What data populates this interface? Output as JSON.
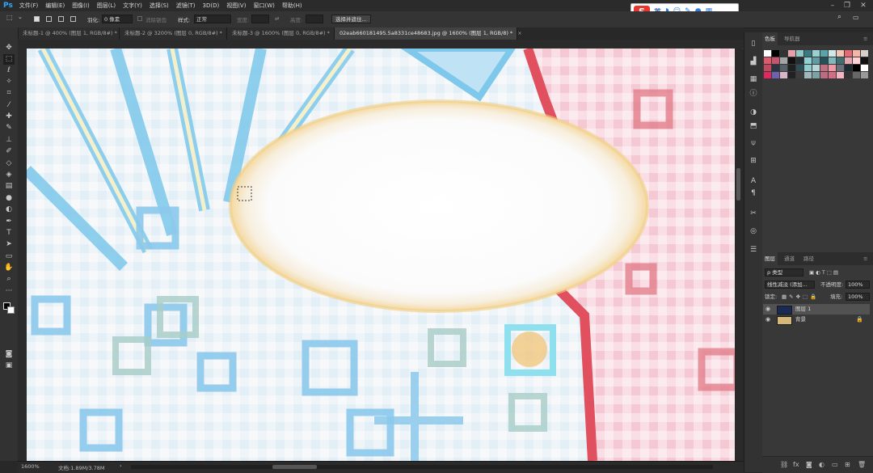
{
  "app": {
    "logo": "Ps"
  },
  "menu": [
    "文件(F)",
    "编辑(E)",
    "图像(I)",
    "图层(L)",
    "文字(Y)",
    "选择(S)",
    "滤镜(T)",
    "3D(D)",
    "视图(V)",
    "窗口(W)",
    "帮助(H)"
  ],
  "ime": {
    "logo": "S",
    "lang": "英",
    "icons": [
      "moon-icon",
      "smile-icon",
      "pen-icon",
      "mic-icon",
      "grid-icon"
    ]
  },
  "options": {
    "feather_label": "羽化:",
    "feather_value": "0 像素",
    "antialias_label": "消除锯齿",
    "style_label": "样式:",
    "style_value": "正常",
    "width_label": "宽度:",
    "height_label": "高度:",
    "select_mask_button": "选择并遮住..."
  },
  "tabs": [
    {
      "label": "未标题-1 @ 400% (图层 1, RGB/8#) *",
      "active": false
    },
    {
      "label": "未标题-2 @ 3200% (图层 0, RGB/8#) *",
      "active": false
    },
    {
      "label": "未标题-3 @ 1600% (图层 0, RGB/8#) *",
      "active": false
    },
    {
      "label": "02eab660181495.5a8331ce48683.jpg @ 1600% (图层 1, RGB/8) *",
      "active": true
    }
  ],
  "status": {
    "zoom": "1600%",
    "doc": "文档:1.89M/3.78M"
  },
  "panels": {
    "swatch_tabs": [
      "色板",
      "导航器"
    ],
    "swatches": [
      "#ffffff",
      "#000000",
      "#333333",
      "#e8a0a8",
      "#8fc9c7",
      "#3b7a83",
      "#9bcfd0",
      "#5aa3a8",
      "#d0e8ea",
      "#f2c7b2",
      "#e46a75",
      "#f5b6a8",
      "#d8d0c8",
      "#e0586a",
      "#c7536d",
      "#a4a4a4",
      "#111111",
      "#262e35",
      "#8ed1d3",
      "#5e9da4",
      "#245157",
      "#7fb9bd",
      "#3d6f74",
      "#e5a8b0",
      "#ffd1d6",
      "#111111",
      "#c04a62",
      "#2a3340",
      "#556068",
      "#202020",
      "#2c4f57",
      "#90cbcd",
      "#b7d6d9",
      "#c07082",
      "#f09aa8",
      "#6c707a",
      "#1c2a33",
      "#000000",
      "#ffffff",
      "#e0285e",
      "#6c63b0",
      "#d9b5c8",
      "#222222",
      "#3d3d3d",
      "#9fb7ba",
      "#7aa2a8",
      "#be6a80",
      "#d66b85",
      "#f3b5c2",
      "#333333",
      "#666666",
      "#999999"
    ],
    "layer_tabs": [
      "图层",
      "通道",
      "路径"
    ],
    "filter_kind": "ρ 类型",
    "blend_mode": "线性减淡 (添加...",
    "opacity_label": "不透明度:",
    "opacity_value": "100%",
    "lock_label": "锁定:",
    "fill_label": "填充:",
    "fill_value": "100%",
    "layers": [
      {
        "name": "图层 1",
        "selected": true,
        "locked": false
      },
      {
        "name": "背景",
        "selected": false,
        "locked": true
      }
    ]
  }
}
